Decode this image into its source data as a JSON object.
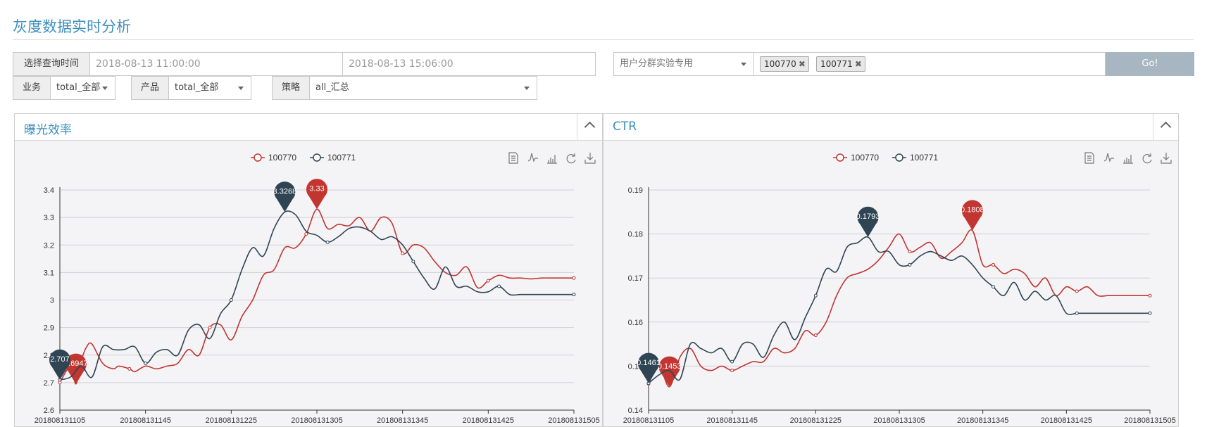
{
  "page": {
    "title": "灰度数据实时分析"
  },
  "filters": {
    "time_label": "选择查询时间",
    "start_time": "2018-08-13 11:00:00",
    "end_time": "2018-08-13 15:06:00",
    "group_select": "用户分群实验专用",
    "groups": [
      "100770",
      "100771"
    ],
    "go_label": "Go!",
    "business_label": "业务",
    "business_value": "total_全部",
    "product_label": "产品",
    "product_value": "total_全部",
    "strategy_label": "策略",
    "strategy_value": "all_汇总"
  },
  "colors": {
    "series_a": "#c23531",
    "series_b": "#2f4554",
    "accent": "#3c8dbc"
  },
  "toolbar_icons": [
    "data-view-icon",
    "line-chart-icon",
    "bar-chart-icon",
    "refresh-icon",
    "download-icon"
  ],
  "chart_data": [
    {
      "type": "line",
      "panel_title": "曝光效率",
      "legend": [
        "100770",
        "100771"
      ],
      "legend_position": "top-center",
      "grid": true,
      "ylim": [
        2.6,
        3.4
      ],
      "yticks": [
        2.6,
        2.7,
        2.8,
        2.9,
        3,
        3.1,
        3.2,
        3.3,
        3.4
      ],
      "xlim": [
        0,
        96
      ],
      "xticks": [
        {
          "label": "201808131105",
          "pos": 0
        },
        {
          "label": "201808131145",
          "pos": 16
        },
        {
          "label": "201808131225",
          "pos": 32
        },
        {
          "label": "201808131305",
          "pos": 48
        },
        {
          "label": "201808131345",
          "pos": 64
        },
        {
          "label": "201808131425",
          "pos": 80
        },
        {
          "label": "201808131505",
          "pos": 96
        }
      ],
      "series": [
        {
          "name": "100770",
          "x": [
            0,
            2,
            3,
            4,
            5,
            6,
            8,
            10,
            11,
            13,
            14,
            16,
            18,
            20,
            22,
            24,
            26,
            28,
            30,
            32,
            34,
            36,
            38,
            40,
            42,
            44,
            46,
            48,
            50,
            52,
            54,
            56,
            58,
            60,
            62,
            64,
            66,
            68,
            70,
            72,
            74,
            76,
            78,
            80,
            82,
            84,
            86,
            88,
            90,
            92,
            94,
            96
          ],
          "y": [
            2.7,
            2.76,
            2.695,
            2.78,
            2.83,
            2.84,
            2.77,
            2.75,
            2.76,
            2.75,
            2.74,
            2.76,
            2.75,
            2.76,
            2.77,
            2.82,
            2.8,
            2.9,
            2.91,
            2.855,
            2.94,
            3.0,
            3.09,
            3.11,
            3.19,
            3.19,
            3.24,
            3.33,
            3.26,
            3.275,
            3.27,
            3.3,
            3.25,
            3.3,
            3.28,
            3.17,
            3.2,
            3.19,
            3.14,
            3.1,
            3.09,
            3.12,
            3.045,
            3.07,
            3.09,
            3.08,
            3.08,
            3.077,
            3.08,
            3.08,
            3.08,
            3.08
          ],
          "max_label": "3.33",
          "min_label": "2.6947"
        },
        {
          "name": "100771",
          "x": [
            0,
            2,
            4,
            6,
            8,
            10,
            12,
            14,
            16,
            18,
            20,
            22,
            24,
            26,
            28,
            30,
            32,
            34,
            36,
            38,
            40,
            42,
            44,
            46,
            48,
            50,
            52,
            54,
            56,
            58,
            60,
            62,
            64,
            66,
            68,
            70,
            72,
            74,
            76,
            78,
            80,
            82,
            84,
            86,
            88,
            90,
            92,
            94,
            96
          ],
          "y": [
            2.71,
            2.72,
            2.76,
            2.72,
            2.83,
            2.82,
            2.82,
            2.83,
            2.77,
            2.81,
            2.82,
            2.8,
            2.89,
            2.91,
            2.86,
            2.95,
            3.0,
            3.11,
            3.19,
            3.16,
            3.26,
            3.32,
            3.31,
            3.25,
            3.235,
            3.21,
            3.23,
            3.26,
            3.265,
            3.25,
            3.22,
            3.23,
            3.2,
            3.14,
            3.08,
            3.04,
            3.12,
            3.05,
            3.05,
            3.03,
            3.03,
            3.05,
            3.02,
            3.02,
            3.02,
            3.02,
            3.02,
            3.02,
            3.02
          ],
          "max_label": "3.3268",
          "min_label": "2.707"
        }
      ]
    },
    {
      "type": "line",
      "panel_title": "CTR",
      "legend": [
        "100770",
        "100771"
      ],
      "legend_position": "top-center",
      "grid": true,
      "ylim": [
        0.14,
        0.19
      ],
      "yticks": [
        0.14,
        0.15,
        0.16,
        0.17,
        0.18,
        0.19
      ],
      "xlim": [
        0,
        96
      ],
      "xticks": [
        {
          "label": "201808131105",
          "pos": 0
        },
        {
          "label": "201808131145",
          "pos": 16
        },
        {
          "label": "201808131225",
          "pos": 32
        },
        {
          "label": "201808131305",
          "pos": 48
        },
        {
          "label": "201808131345",
          "pos": 64
        },
        {
          "label": "201808131425",
          "pos": 80
        },
        {
          "label": "201808131505",
          "pos": 96
        }
      ],
      "series": [
        {
          "name": "100770",
          "x": [
            0,
            2,
            4,
            6,
            8,
            10,
            12,
            14,
            16,
            18,
            20,
            22,
            24,
            26,
            28,
            30,
            32,
            34,
            36,
            38,
            40,
            42,
            44,
            46,
            48,
            50,
            52,
            54,
            56,
            58,
            60,
            62,
            64,
            66,
            68,
            70,
            72,
            74,
            76,
            78,
            80,
            82,
            84,
            86,
            88,
            90,
            92,
            94,
            96
          ],
          "y": [
            0.146,
            0.15,
            0.1453,
            0.152,
            0.154,
            0.15,
            0.149,
            0.15,
            0.149,
            0.15,
            0.151,
            0.151,
            0.154,
            0.153,
            0.154,
            0.158,
            0.157,
            0.16,
            0.166,
            0.17,
            0.171,
            0.172,
            0.174,
            0.177,
            0.18,
            0.176,
            0.177,
            0.178,
            0.1745,
            0.176,
            0.178,
            0.1808,
            0.173,
            0.173,
            0.171,
            0.172,
            0.171,
            0.168,
            0.17,
            0.166,
            0.168,
            0.167,
            0.168,
            0.166,
            0.166,
            0.166,
            0.166,
            0.166,
            0.166
          ],
          "max_label": "0.1808",
          "min_label": "0.1453"
        },
        {
          "name": "100771",
          "x": [
            0,
            2,
            4,
            6,
            8,
            10,
            12,
            14,
            16,
            18,
            20,
            22,
            24,
            26,
            28,
            30,
            32,
            34,
            36,
            38,
            40,
            42,
            44,
            46,
            48,
            50,
            52,
            54,
            56,
            58,
            60,
            62,
            64,
            66,
            68,
            70,
            72,
            74,
            76,
            78,
            80,
            82,
            84,
            86,
            88,
            90,
            92,
            94,
            96
          ],
          "y": [
            0.1461,
            0.148,
            0.149,
            0.147,
            0.155,
            0.154,
            0.153,
            0.154,
            0.151,
            0.155,
            0.155,
            0.152,
            0.157,
            0.16,
            0.156,
            0.161,
            0.166,
            0.172,
            0.1715,
            0.177,
            0.178,
            0.1793,
            0.176,
            0.176,
            0.173,
            0.173,
            0.175,
            0.176,
            0.175,
            0.174,
            0.175,
            0.173,
            0.17,
            0.168,
            0.166,
            0.169,
            0.165,
            0.167,
            0.165,
            0.166,
            0.162,
            0.162,
            0.162,
            0.162,
            0.162,
            0.162,
            0.162,
            0.162,
            0.162
          ],
          "max_label": "0.1793",
          "min_label": "0.1461"
        }
      ]
    }
  ]
}
